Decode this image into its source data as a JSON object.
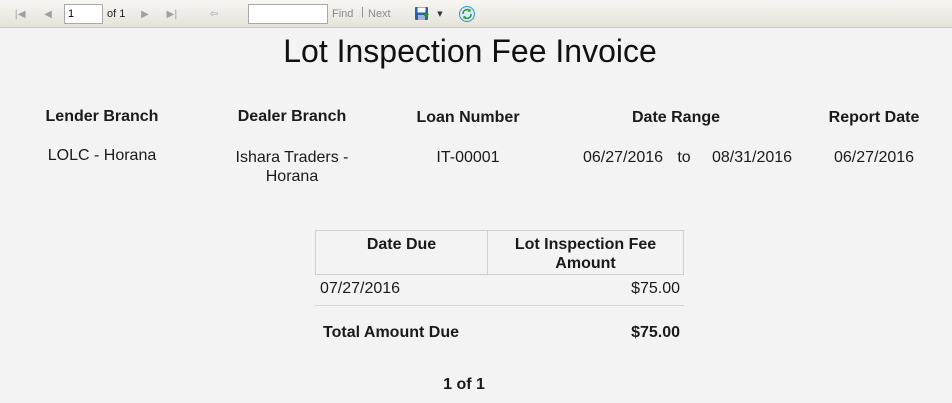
{
  "toolbar": {
    "page_value": "1",
    "of_label": "of 1",
    "find_label": "Find",
    "separator": "|",
    "next_label": "Next"
  },
  "report": {
    "title": "Lot Inspection Fee Invoice",
    "headers": {
      "lender_branch": "Lender Branch",
      "dealer_branch": "Dealer Branch",
      "loan_number": "Loan Number",
      "date_range": "Date Range",
      "report_date": "Report Date"
    },
    "values": {
      "lender_branch": "LOLC - Horana",
      "dealer_branch_line1": "Ishara Traders -",
      "dealer_branch_line2": "Horana",
      "loan_number": "IT-00001",
      "date_from": "06/27/2016",
      "date_to_label": "to",
      "date_to": "08/31/2016",
      "report_date": "06/27/2016"
    },
    "table": {
      "col_date_due": "Date Due",
      "col_amount_line1": "Lot Inspection Fee",
      "col_amount_line2": "Amount",
      "rows": [
        {
          "date_due": "07/27/2016",
          "amount": "$75.00"
        }
      ],
      "total_label": "Total Amount Due",
      "total_amount": "$75.00"
    },
    "page_footer": "1 of 1"
  }
}
